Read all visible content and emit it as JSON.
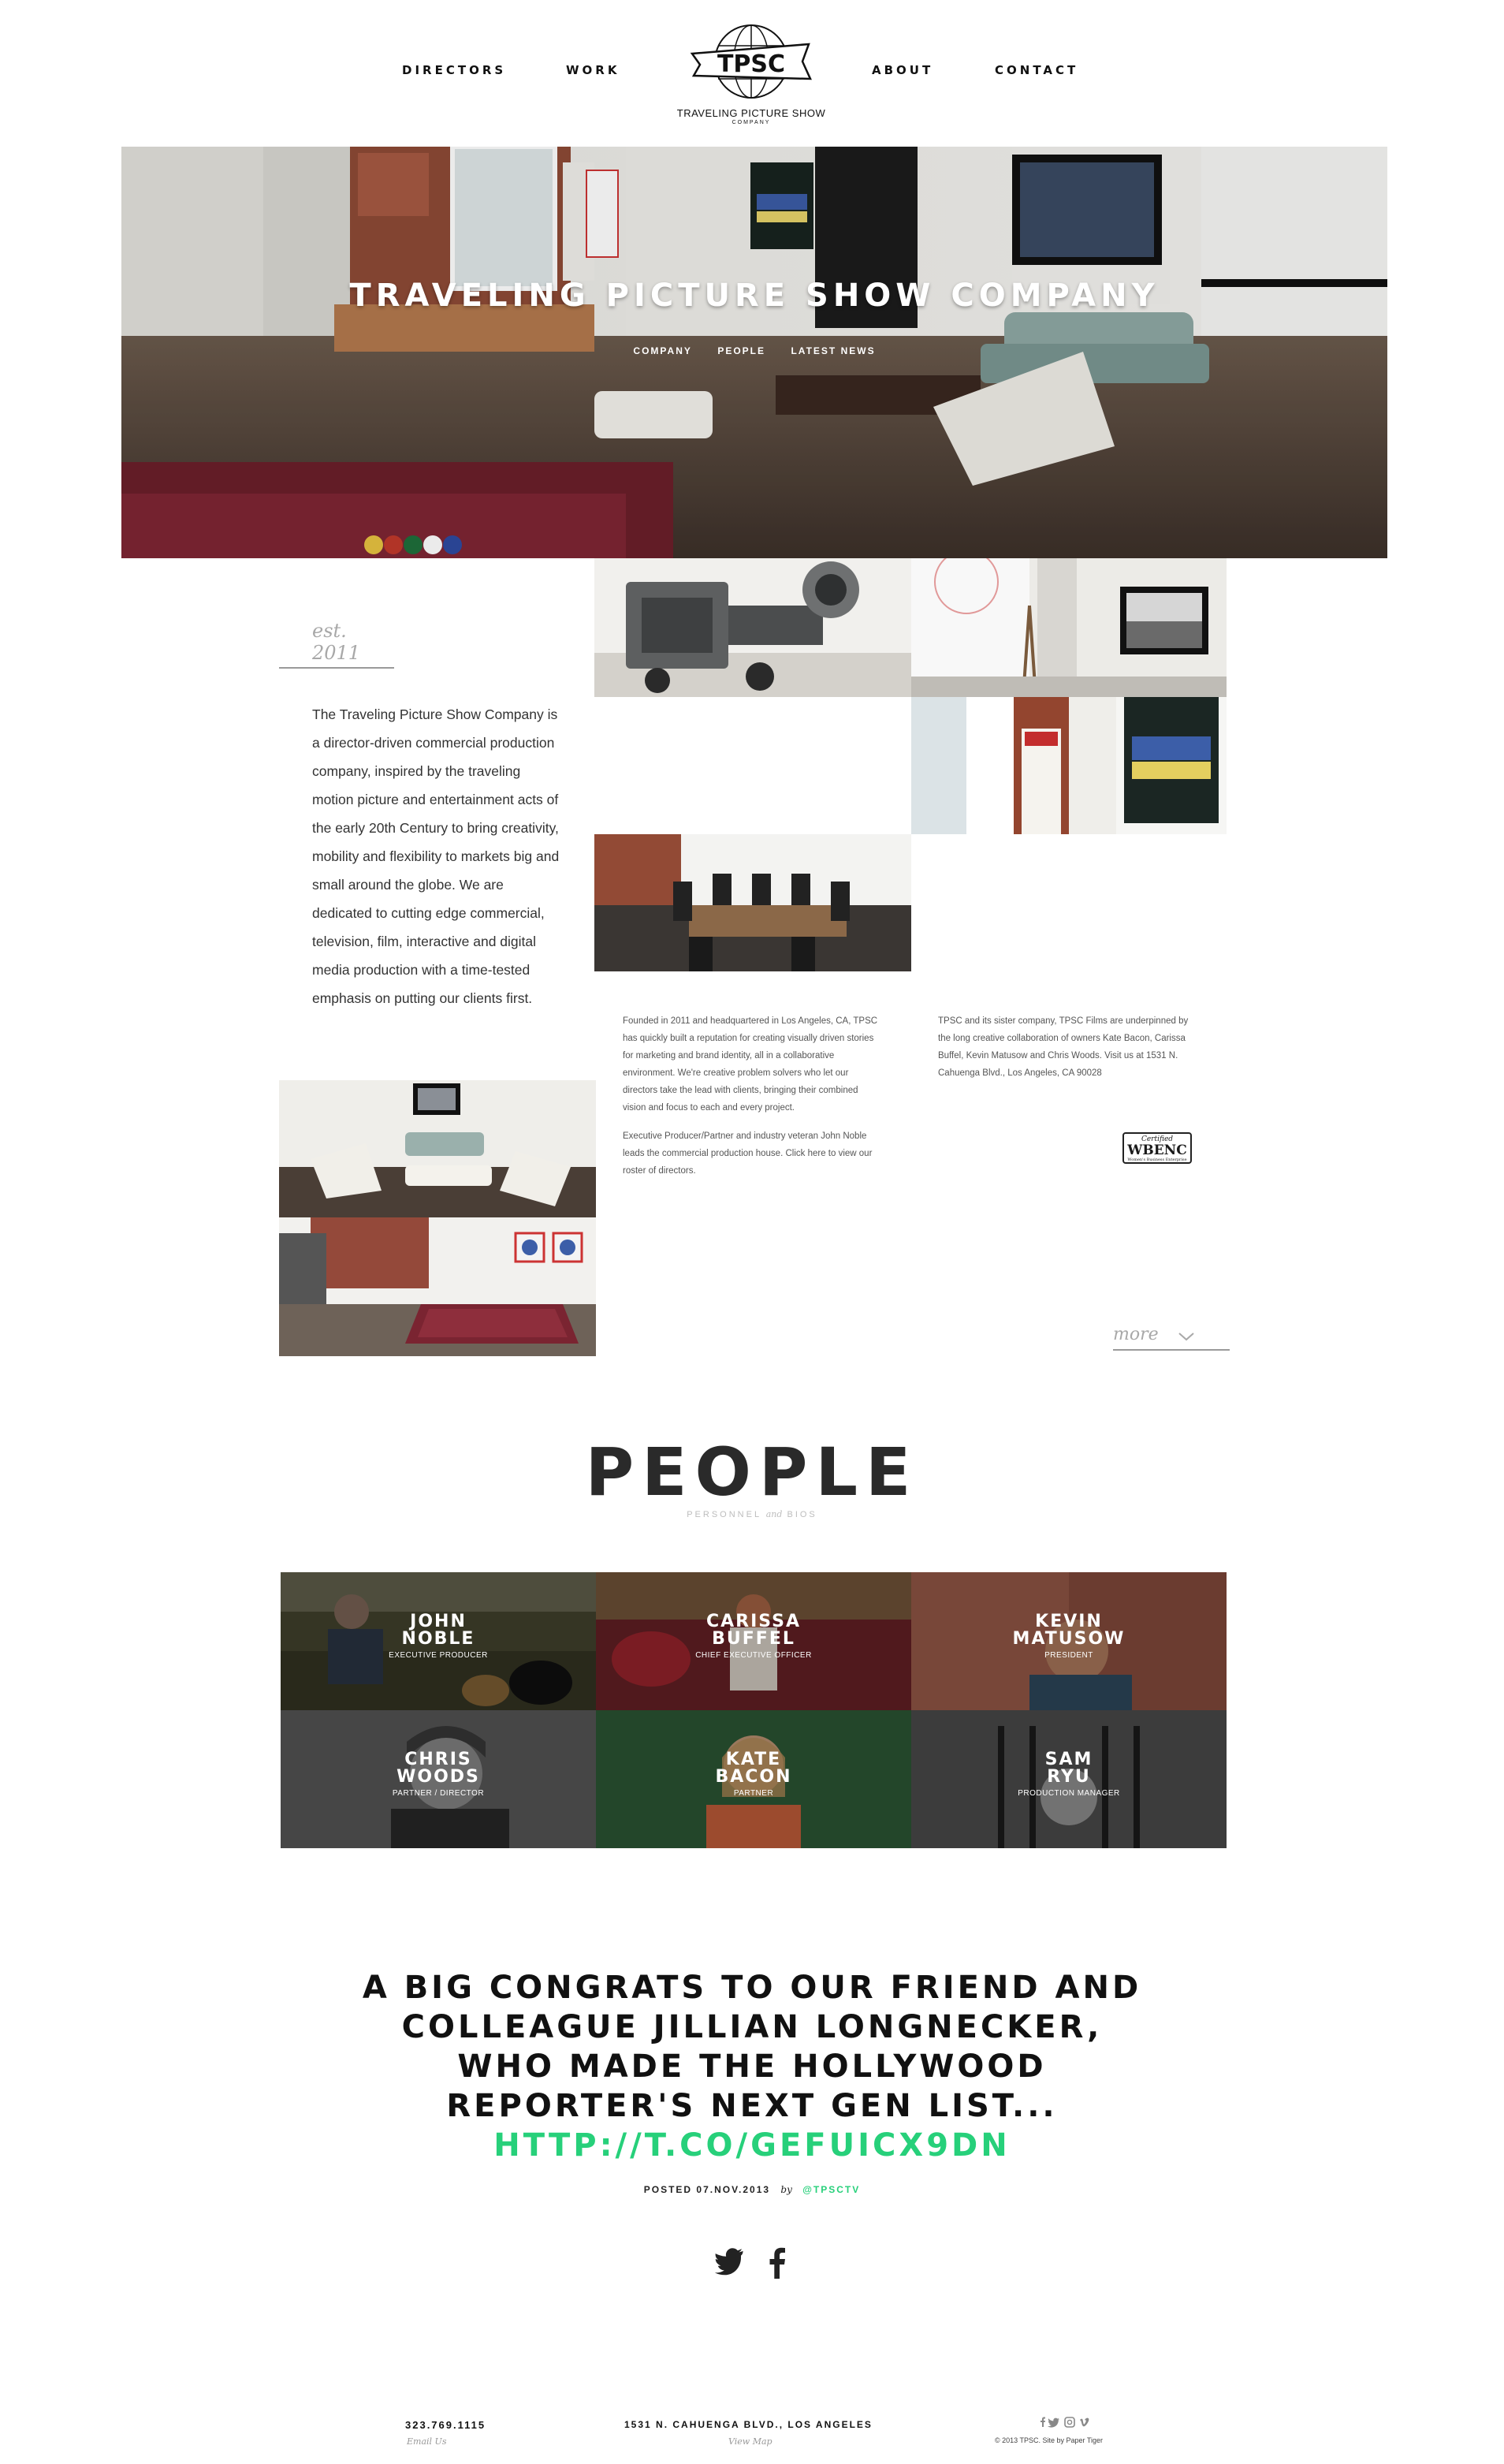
{
  "nav": {
    "directors": "DIRECTORS",
    "work": "WORK",
    "about": "ABOUT",
    "contact": "CONTACT",
    "logo_text": "TPSC",
    "logo_caption": "TRAVELING PICTURE SHOW",
    "logo_sub": "COMPANY"
  },
  "hero": {
    "title": "TRAVELING PICTURE SHOW COMPANY",
    "subnav": [
      "COMPANY",
      "PEOPLE",
      "LATEST NEWS"
    ]
  },
  "company": {
    "est": "est. 2011",
    "intro": "The Traveling Picture Show Company is a director-driven commercial production company, inspired by the traveling motion picture and entertainment acts of the early 20th Century to bring creativity, mobility and flexibility to markets big and small around the globe. We are dedicated to cutting edge commercial, television, film, interactive and digital media production with a time-tested emphasis on putting our clients first.",
    "col_a_p1": "Founded in 2011 and headquartered in Los Angeles, CA, TPSC has quickly built a reputation for creating visually driven stories for marketing and brand identity, all in a collaborative environment. We're creative problem solvers who let our directors take the lead with clients, bringing their combined vision and focus to each and every project.",
    "col_a_p2": "Executive Producer/Partner and industry veteran John Noble leads the commercial production house. Click here to view our roster of directors.",
    "col_b": "TPSC and its sister company, TPSC Films are underpinned by the long creative collaboration of owners Kate Bacon, Carissa Buffel, Kevin Matusow and Chris Woods. Visit us at 1531 N. Cahuenga Blvd., Los Angeles, CA 90028",
    "badge_certified": "Certified",
    "badge_name": "WBENC",
    "badge_sub": "Women's Business Enterprise",
    "more": "more"
  },
  "people": {
    "title": "PEOPLE",
    "sub_left": "PERSONNEL",
    "sub_and": "and",
    "sub_right": "BIOS",
    "members": [
      {
        "first": "JOHN",
        "last": "NOBLE",
        "role": "EXECUTIVE PRODUCER"
      },
      {
        "first": "CARISSA",
        "last": "BUFFEL",
        "role": "CHIEF EXECUTIVE OFFICER"
      },
      {
        "first": "KEVIN",
        "last": "MATUSOW",
        "role": "PRESIDENT"
      },
      {
        "first": "CHRIS",
        "last": "WOODS",
        "role": "PARTNER / DIRECTOR"
      },
      {
        "first": "KATE",
        "last": "BACON",
        "role": "PARTNER"
      },
      {
        "first": "SAM",
        "last": "RYU",
        "role": "PRODUCTION MANAGER"
      }
    ]
  },
  "tweet": {
    "text": "A BIG CONGRATS TO OUR FRIEND AND COLLEAGUE JILLIAN LONGNECKER, WHO MADE THE HOLLYWOOD REPORTER'S NEXT GEN LIST... ",
    "link": "HTTP://T.CO/GEFUICX9DN",
    "posted": "POSTED 07.NOV.2013",
    "by": "by",
    "handle": "@TPSCTV"
  },
  "footer": {
    "phone": "323.769.1115",
    "email": "Email Us",
    "address": "1531 N. CAHUENGA BLVD., LOS ANGELES",
    "map": "View Map",
    "copyright": "© 2013 TPSC. Site by Paper Tiger"
  },
  "colors": {
    "accent_green": "#27d07a",
    "text_dark": "#1a1a1a",
    "muted_gray": "#a8a8a8"
  }
}
